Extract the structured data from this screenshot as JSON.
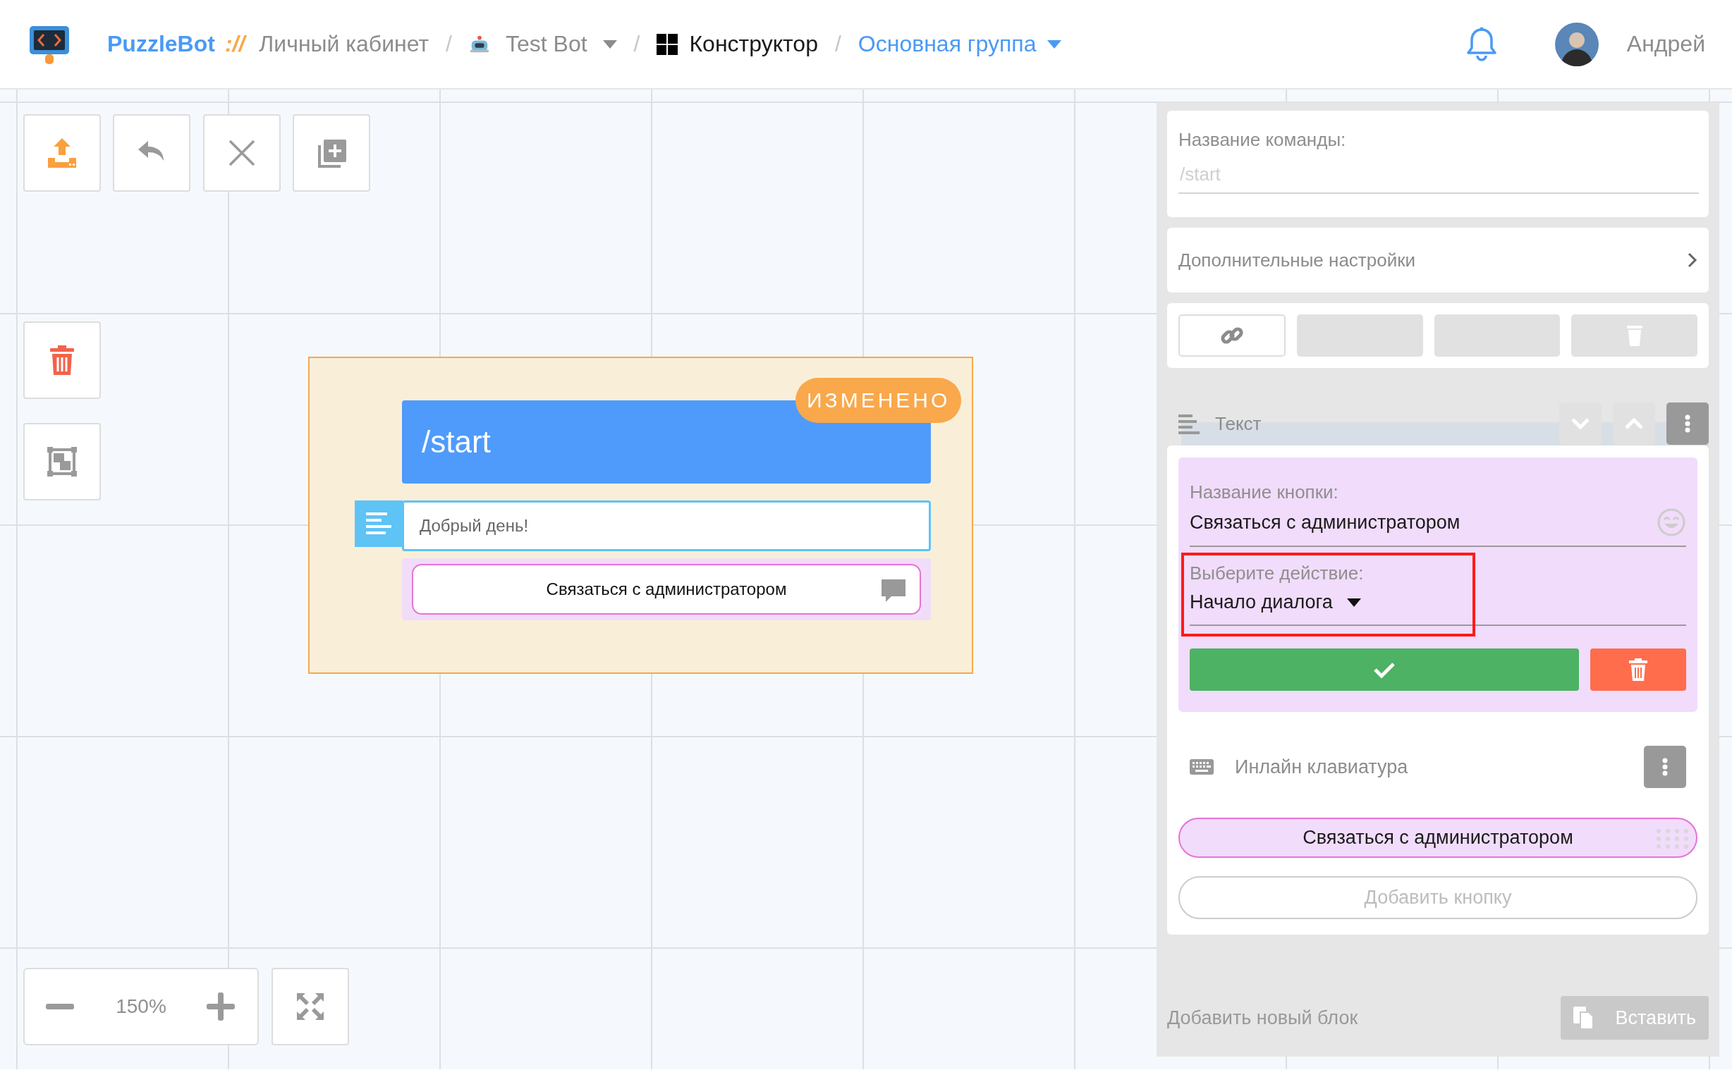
{
  "header": {
    "brand": "PuzzleBot",
    "separator": "://",
    "breadcrumbs": [
      {
        "label": "Личный кабинет",
        "kind": "plain"
      },
      {
        "divider": "/",
        "label": "Test Bot",
        "kind": "bot"
      },
      {
        "divider": "/",
        "label": "Конструктор",
        "kind": "page"
      },
      {
        "divider": "/",
        "label": "Основная группа",
        "kind": "group"
      }
    ],
    "user": {
      "name": "Андрей"
    }
  },
  "canvas": {
    "zoom": "150%",
    "node": {
      "command": "/start",
      "badge": "ИЗМЕНЕНО",
      "message": "Добрый день!",
      "buttons": [
        "Связаться с администратором"
      ]
    }
  },
  "panel": {
    "command_field": {
      "label": "Название команды:",
      "placeholder": "/start"
    },
    "settings_link": "Дополнительные настройки",
    "text_block": {
      "title": "Текст"
    },
    "button_editor": {
      "name_field": {
        "label": "Название кнопки:",
        "value": "Связаться с администратором"
      },
      "action_field": {
        "label": "Выберите действие:",
        "value": "Начало диалога",
        "highlighted": true
      }
    },
    "keyboard": {
      "title": "Инлайн клавиатура",
      "buttons": [
        "Связаться с администратором"
      ],
      "add_button": "Добавить кнопку"
    },
    "add_block": "Добавить новый блок",
    "paste_button": "Вставить"
  }
}
